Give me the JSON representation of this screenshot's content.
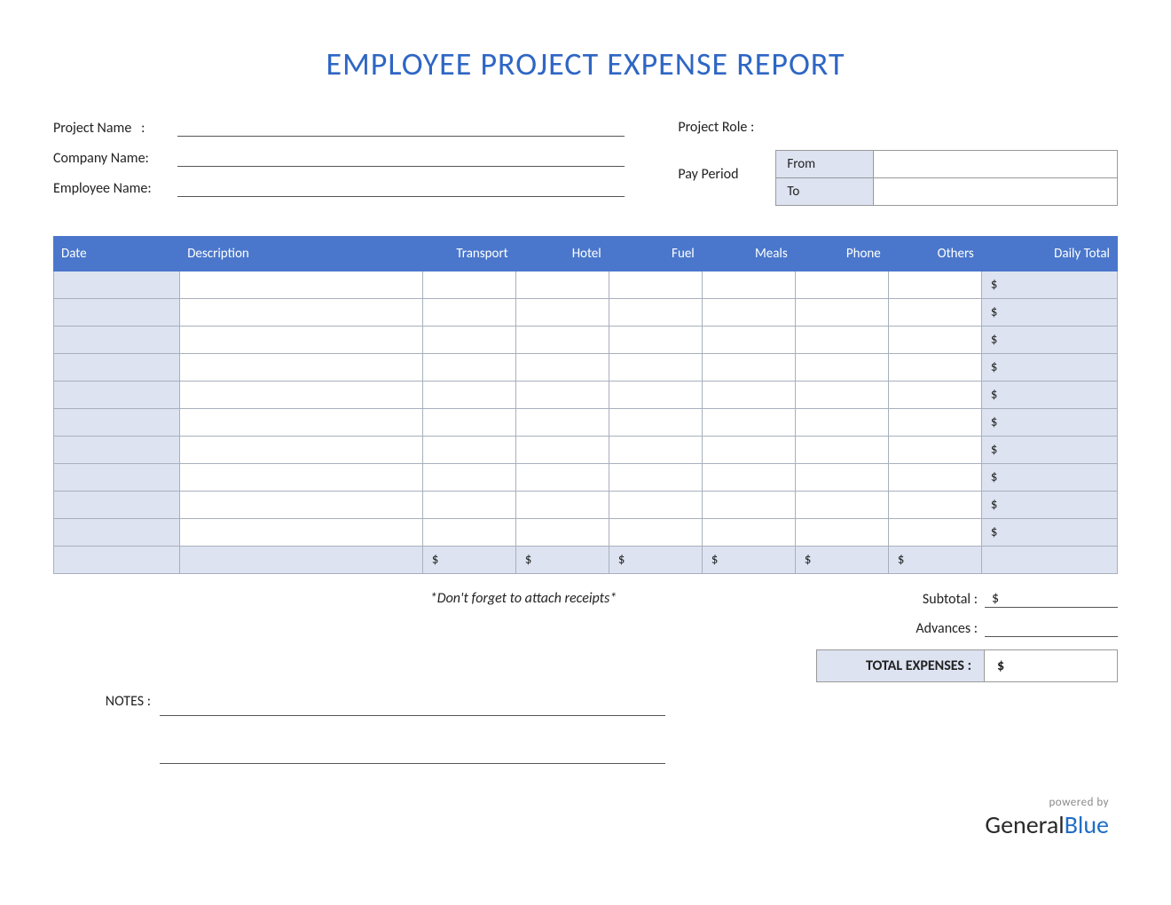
{
  "title": "EMPLOYEE PROJECT EXPENSE REPORT",
  "fields": {
    "project_name_label": "Project Name",
    "project_name_sep": ":",
    "company_name_label": "Company Name:",
    "employee_name_label": "Employee Name:",
    "project_role_label": "Project Role :",
    "pay_period_label": "Pay Period",
    "from_label": "From",
    "to_label": "To",
    "project_name_value": "",
    "company_name_value": "",
    "employee_name_value": "",
    "project_role_value": "",
    "from_value": "",
    "to_value": ""
  },
  "columns": {
    "date": "Date",
    "description": "Description",
    "transport": "Transport",
    "hotel": "Hotel",
    "fuel": "Fuel",
    "meals": "Meals",
    "phone": "Phone",
    "others": "Others",
    "daily_total": "Daily Total"
  },
  "currency": "$",
  "rows": [
    {
      "date": "",
      "description": "",
      "transport": "",
      "hotel": "",
      "fuel": "",
      "meals": "",
      "phone": "",
      "others": "",
      "daily_total": "$"
    },
    {
      "date": "",
      "description": "",
      "transport": "",
      "hotel": "",
      "fuel": "",
      "meals": "",
      "phone": "",
      "others": "",
      "daily_total": "$"
    },
    {
      "date": "",
      "description": "",
      "transport": "",
      "hotel": "",
      "fuel": "",
      "meals": "",
      "phone": "",
      "others": "",
      "daily_total": "$"
    },
    {
      "date": "",
      "description": "",
      "transport": "",
      "hotel": "",
      "fuel": "",
      "meals": "",
      "phone": "",
      "others": "",
      "daily_total": "$"
    },
    {
      "date": "",
      "description": "",
      "transport": "",
      "hotel": "",
      "fuel": "",
      "meals": "",
      "phone": "",
      "others": "",
      "daily_total": "$"
    },
    {
      "date": "",
      "description": "",
      "transport": "",
      "hotel": "",
      "fuel": "",
      "meals": "",
      "phone": "",
      "others": "",
      "daily_total": "$"
    },
    {
      "date": "",
      "description": "",
      "transport": "",
      "hotel": "",
      "fuel": "",
      "meals": "",
      "phone": "",
      "others": "",
      "daily_total": "$"
    },
    {
      "date": "",
      "description": "",
      "transport": "",
      "hotel": "",
      "fuel": "",
      "meals": "",
      "phone": "",
      "others": "",
      "daily_total": "$"
    },
    {
      "date": "",
      "description": "",
      "transport": "",
      "hotel": "",
      "fuel": "",
      "meals": "",
      "phone": "",
      "others": "",
      "daily_total": "$"
    },
    {
      "date": "",
      "description": "",
      "transport": "",
      "hotel": "",
      "fuel": "",
      "meals": "",
      "phone": "",
      "others": "",
      "daily_total": "$"
    }
  ],
  "column_totals": {
    "transport": "$",
    "hotel": "$",
    "fuel": "$",
    "meals": "$",
    "phone": "$",
    "others": "$"
  },
  "reminder": "*Don't forget to attach receipts*",
  "summary": {
    "subtotal_label": "Subtotal :",
    "subtotal_value": "$",
    "advances_label": "Advances :",
    "advances_value": "",
    "total_label": "TOTAL EXPENSES :",
    "total_value": "$"
  },
  "notes_label": "NOTES :",
  "footer": {
    "powered_by": "powered by",
    "brand_a": "General",
    "brand_b": "Blue"
  }
}
